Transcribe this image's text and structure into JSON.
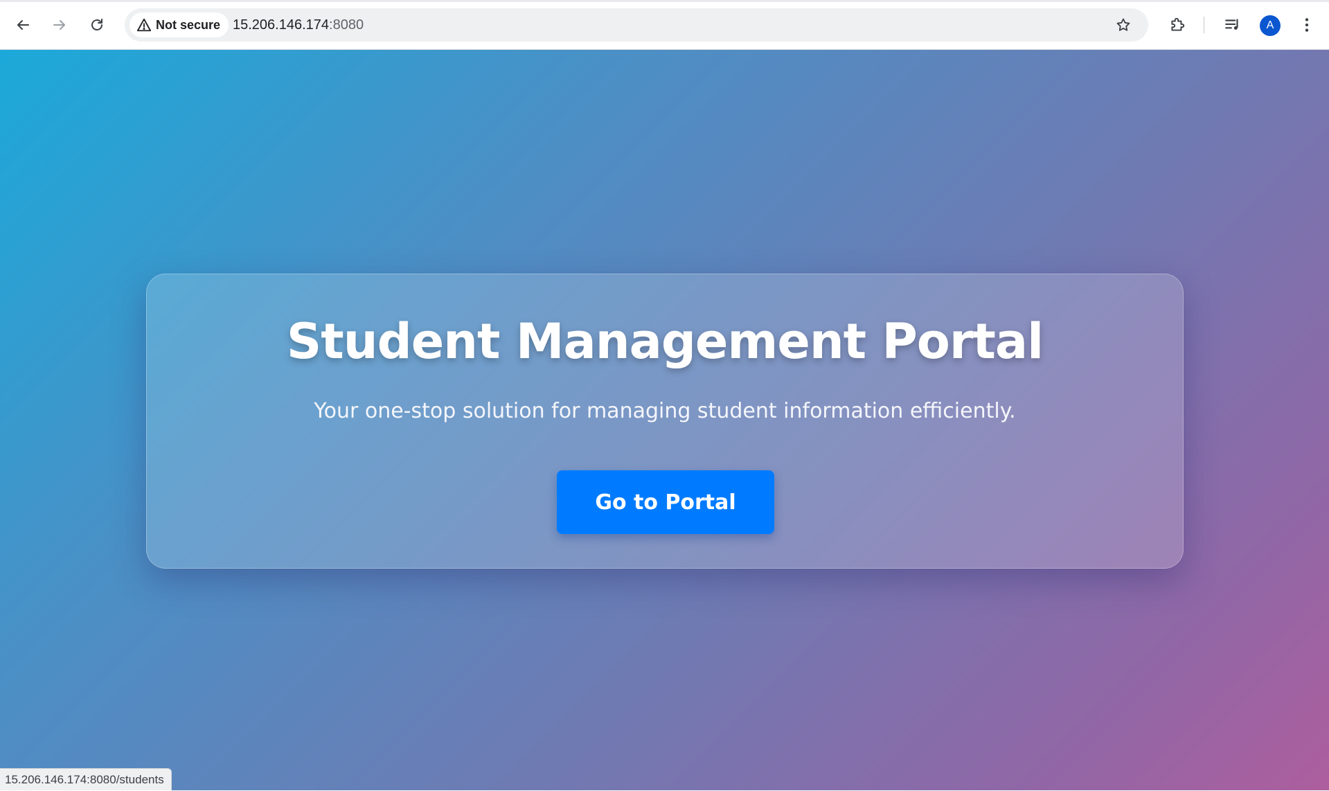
{
  "browser": {
    "security_label": "Not secure",
    "url_host": "15.206.146.174",
    "url_port": ":8080",
    "profile_initial": "A",
    "status_url": "15.206.146.174:8080/students"
  },
  "page": {
    "title": "Student Management Portal",
    "subtitle": "Your one-stop solution for managing student information efficiently.",
    "cta_label": "Go to Portal"
  },
  "colors": {
    "gradient_start": "#1ba9d9",
    "gradient_end": "#ad5e9e",
    "button": "#007bff",
    "avatar": "#0b57d0"
  },
  "icons": {
    "back": "arrow-left-icon",
    "forward": "arrow-right-icon",
    "reload": "reload-icon",
    "warning": "warning-triangle-icon",
    "bookmark": "star-icon",
    "extensions": "puzzle-icon",
    "media": "media-queue-icon",
    "menu": "kebab-menu-icon"
  }
}
